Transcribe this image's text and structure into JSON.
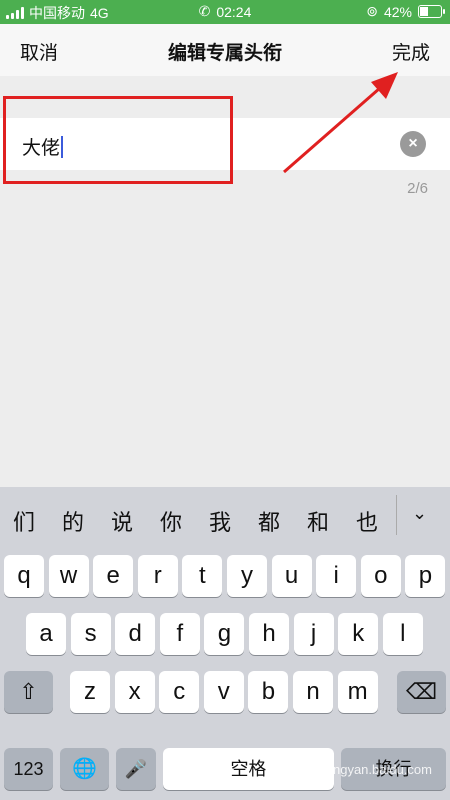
{
  "status": {
    "carrier": "中国移动",
    "network": "4G",
    "time": "02:24",
    "battery": "42%",
    "battery_level": 0.42
  },
  "nav": {
    "cancel": "取消",
    "title": "编辑专属头衔",
    "done": "完成"
  },
  "input": {
    "value": "大佬",
    "clear_icon": "×",
    "counter": "2/6"
  },
  "keyboard": {
    "candidates": [
      "们",
      "的",
      "说",
      "你",
      "我",
      "都",
      "和",
      "也"
    ],
    "collapse_icon": "⌄",
    "row1": [
      "q",
      "w",
      "e",
      "r",
      "t",
      "y",
      "u",
      "i",
      "o",
      "p"
    ],
    "row2": [
      "a",
      "s",
      "d",
      "f",
      "g",
      "h",
      "j",
      "k",
      "l"
    ],
    "row3": [
      "z",
      "x",
      "c",
      "v",
      "b",
      "n",
      "m"
    ],
    "shift_icon": "⇧",
    "delete_icon": "⌫",
    "numbers_key": "123",
    "globe_icon": "🌐",
    "mic_icon": "🎤",
    "space_key": "空格",
    "return_key": "换行"
  },
  "watermark": "Baidu经验 jingyan.baidu.com",
  "colors": {
    "status_bar": "#4caf50",
    "annotation": "#e02020",
    "cursor": "#3b5bdb"
  }
}
